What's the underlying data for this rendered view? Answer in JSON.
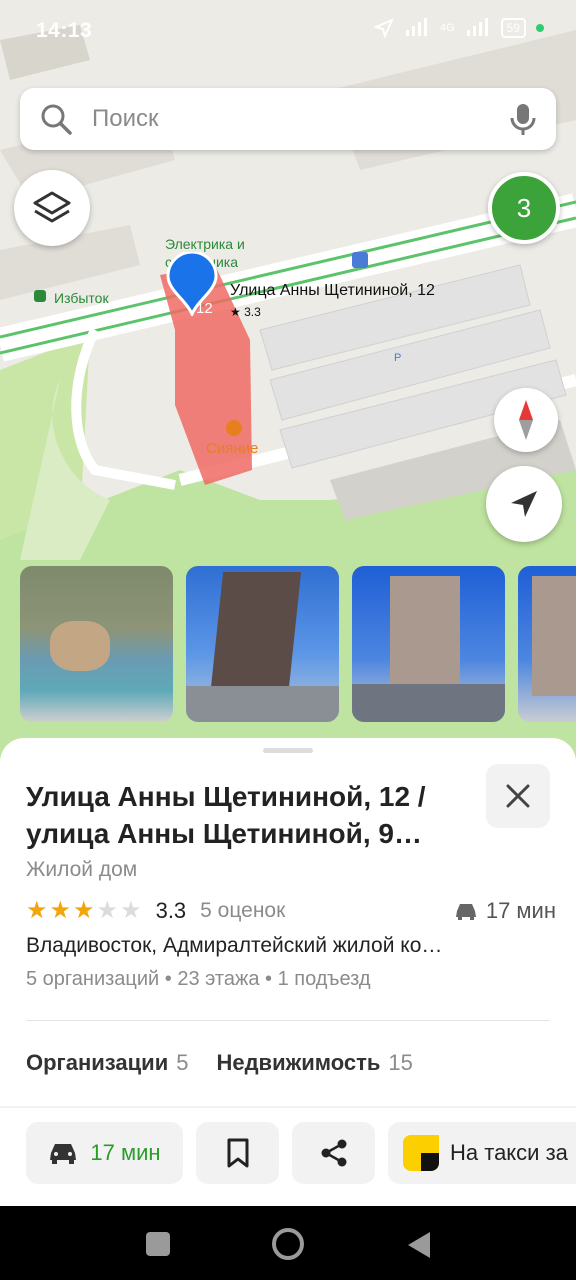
{
  "status_bar": {
    "time": "14:13",
    "network": "4G",
    "battery": "59"
  },
  "search": {
    "placeholder": "Поиск"
  },
  "map": {
    "cluster_count": "3",
    "labels": {
      "shop1": "Электрика и",
      "shop1b": "сантехника",
      "shop2": "Избыток",
      "address": "Улица Анны Щетининой, 12",
      "rating": "★ 3.3",
      "house_number": "12",
      "poi": "Сияние",
      "p": "P"
    }
  },
  "place": {
    "title_line1": "Улица Анны Щетининой, 12 /",
    "title_line2": "улица Анны Щетининой, 9…",
    "type": "Жилой дом",
    "rating": "3.3",
    "stars_filled": 3,
    "stars_total": 5,
    "reviews": "5 оценок",
    "drive_time": "17 мин",
    "address": "Владивосток, Адмиралтейский жилой ко…",
    "meta": "5 организаций • 23 этажа • 1 подъезд",
    "tabs": [
      {
        "label": "Организации",
        "count": "5"
      },
      {
        "label": "Недвижимость",
        "count": "15"
      }
    ]
  },
  "actions": {
    "route_label": "17 мин",
    "taxi_label": "На такси за"
  },
  "colors": {
    "accent_green": "#2a9c2a",
    "pin_blue": "#1a73e8",
    "building_red": "#f06a64",
    "star_gold": "#f2a60c",
    "cluster_green": "#3ba33a"
  }
}
